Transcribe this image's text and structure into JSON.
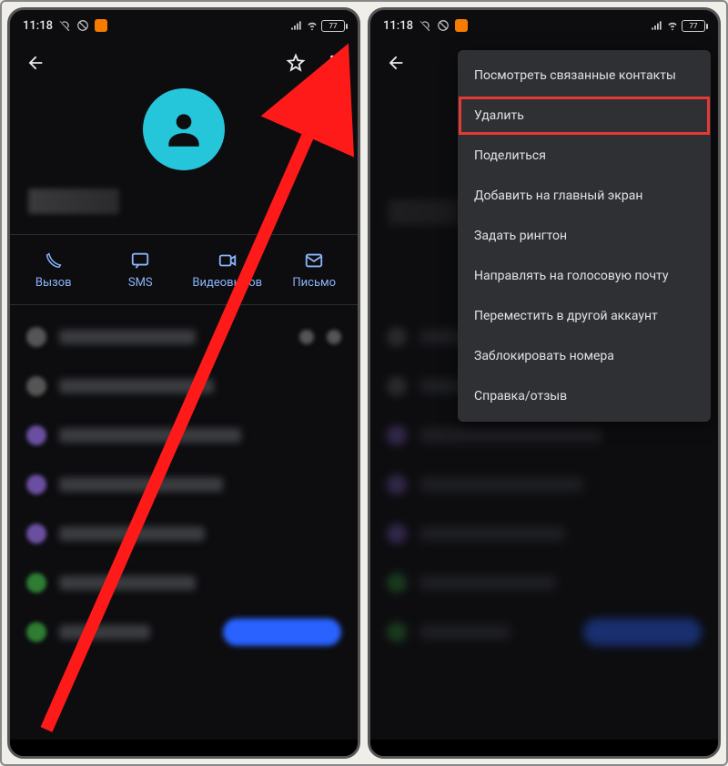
{
  "status": {
    "time": "11:18",
    "battery": "77"
  },
  "actions": {
    "call": "Вызов",
    "sms": "SMS",
    "video": "Видеовызов",
    "email": "Письмо"
  },
  "menu": {
    "view_linked": "Посмотреть связанные контакты",
    "delete": "Удалить",
    "share": "Поделиться",
    "add_home": "Добавить на главный экран",
    "ringtone": "Задать рингтон",
    "voicemail": "Направлять на голосовую почту",
    "move_account": "Переместить в другой аккаунт",
    "block": "Заблокировать номера",
    "help": "Справка/отзыв"
  }
}
